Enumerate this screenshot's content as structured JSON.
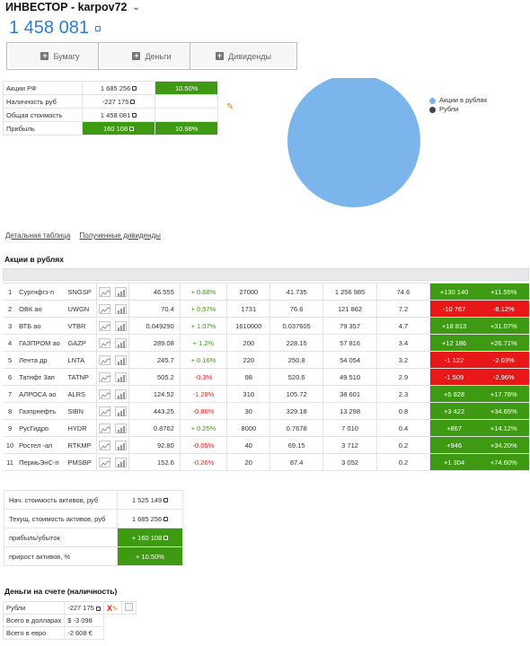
{
  "header": {
    "title": "ИНВЕСТОР - karpov72",
    "total": "1 458 081"
  },
  "buttons": [
    {
      "label": "Бумагу"
    },
    {
      "label": "Деньги"
    },
    {
      "label": "Дивиденды"
    }
  ],
  "summary": {
    "rows": [
      {
        "label": "Акции РФ",
        "value": "1 685 256",
        "pct": "10.50%"
      },
      {
        "label": "Наличность руб",
        "value": "-227 175",
        "pct": ""
      },
      {
        "label": "Общая стоимость",
        "value": "1 458 081",
        "pct": ""
      },
      {
        "label": "Прибыль",
        "value": "160 108",
        "pct": "10.98%"
      }
    ]
  },
  "pie": {
    "legend": [
      {
        "name": "Акции в рублях",
        "color": "#7cb5ec"
      },
      {
        "name": "Рубли",
        "color": "#434348"
      }
    ]
  },
  "links": {
    "detail": "Детальная таблица",
    "dividends": "Полученные дивиденды"
  },
  "stocks": {
    "title": "Акции в рублях",
    "rows": [
      {
        "n": "1",
        "name": "Сургнфгз-п",
        "ticker": "SNGSP",
        "price": "46.555",
        "change": "+ 0.68%",
        "qty": "27000",
        "avg": "41.735",
        "value": "1 256 985",
        "share": "74.6",
        "profit": "+130 140",
        "profit_pct": "+11.55%"
      },
      {
        "n": "2",
        "name": "ОВК ао",
        "ticker": "UWGN",
        "price": "70.4",
        "change": "+ 0.57%",
        "qty": "1731",
        "avg": "76.6",
        "value": "121 862",
        "share": "7.2",
        "profit": "-10 767",
        "profit_pct": "-8.12%"
      },
      {
        "n": "3",
        "name": "ВТБ ао",
        "ticker": "VTBR",
        "price": "0.049290",
        "change": "+ 1.07%",
        "qty": "1610000",
        "avg": "0.037605",
        "value": "79 357",
        "share": "4.7",
        "profit": "+18 813",
        "profit_pct": "+31.07%"
      },
      {
        "n": "4",
        "name": "ГАЗПРОМ ао",
        "ticker": "GAZP",
        "price": "289.08",
        "change": "+ 1.2%",
        "qty": "200",
        "avg": "228.15",
        "value": "57 816",
        "share": "3.4",
        "profit": "+12 186",
        "profit_pct": "+26.71%"
      },
      {
        "n": "5",
        "name": "Лента др",
        "ticker": "LNTA",
        "price": "245.7",
        "change": "+ 0.16%",
        "qty": "220",
        "avg": "250.8",
        "value": "54 054",
        "share": "3.2",
        "profit": "-1 122",
        "profit_pct": "-2.03%"
      },
      {
        "n": "6",
        "name": "Татнфт 3ап",
        "ticker": "TATNP",
        "price": "505.2",
        "change": "-0.3%",
        "qty": "98",
        "avg": "520.6",
        "value": "49 510",
        "share": "2.9",
        "profit": "-1 509",
        "profit_pct": "-2.96%"
      },
      {
        "n": "7",
        "name": "АЛРОСА ао",
        "ticker": "ALRS",
        "price": "124.52",
        "change": "-1.28%",
        "qty": "310",
        "avg": "105.72",
        "value": "38 601",
        "share": "2.3",
        "profit": "+5 828",
        "profit_pct": "+17.78%"
      },
      {
        "n": "8",
        "name": "Газпрнефть",
        "ticker": "SIBN",
        "price": "443.25",
        "change": "-0.86%",
        "qty": "30",
        "avg": "329.18",
        "value": "13 298",
        "share": "0.8",
        "profit": "+3 422",
        "profit_pct": "+34.65%"
      },
      {
        "n": "9",
        "name": "РусГидро",
        "ticker": "HYDR",
        "price": "0.8762",
        "change": "+ 0.25%",
        "qty": "8000",
        "avg": "0.7678",
        "value": "7 010",
        "share": "0.4",
        "profit": "+867",
        "profit_pct": "+14.12%"
      },
      {
        "n": "10",
        "name": "Ростел -ап",
        "ticker": "RTKMP",
        "price": "92.80",
        "change": "-0.05%",
        "qty": "40",
        "avg": "69.15",
        "value": "3 712",
        "share": "0.2",
        "profit": "+946",
        "profit_pct": "+34.20%"
      },
      {
        "n": "11",
        "name": "ПермьЭнС-п",
        "ticker": "PMSBP",
        "price": "152.6",
        "change": "-0.26%",
        "qty": "20",
        "avg": "87.4",
        "value": "3 052",
        "share": "0.2",
        "profit": "+1 304",
        "profit_pct": "+74.60%"
      }
    ]
  },
  "totals": {
    "rows": [
      {
        "label": "Нач. стоимость активов, руб",
        "value": "1 525 149"
      },
      {
        "label": "Текущ. стоимость активов, руб",
        "value": "1 685 256"
      },
      {
        "label": "прибыль/убыток",
        "value": "+ 160 108"
      },
      {
        "label": "прирост активов, %",
        "value": "+ 10.50%"
      }
    ]
  },
  "cash": {
    "title": "Деньги на счете (наличность)",
    "rows": [
      {
        "label": "Рубли",
        "value": "-227 175"
      },
      {
        "label": "Всего в долларах",
        "value": "$ -3 098"
      },
      {
        "label": "Всего в евро",
        "value": "-2 608 €"
      }
    ],
    "delete_glyph": "X"
  }
}
